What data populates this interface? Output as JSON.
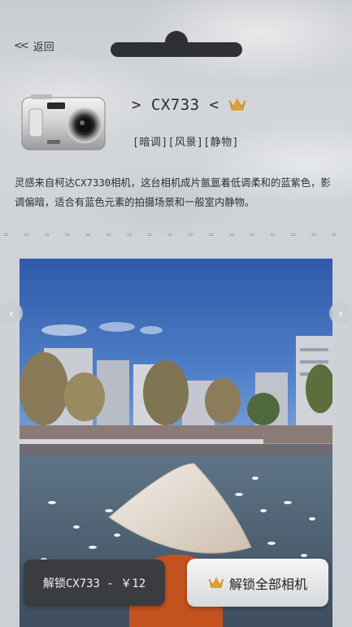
{
  "header": {
    "back_label": "返回"
  },
  "camera": {
    "model_title": "> CX733 <",
    "tags": "[暗调][风景][静物]",
    "description": "灵感来自柯达CX7330相机，这台相机成片氤氲着低调柔和的蓝紫色，影调偏暗，适合有蓝色元素的拍摄场景和一般室内静物。"
  },
  "divider": "= = = = = = = = = = = = = = = = = = = = = = = = = = = = = = = = =",
  "buttons": {
    "unlock_one": "解锁CX733 - ￥12",
    "unlock_all": "解锁全部相机"
  },
  "colors": {
    "accent_gold": "#e0a22a",
    "button_dark": "#3a3c3f"
  }
}
